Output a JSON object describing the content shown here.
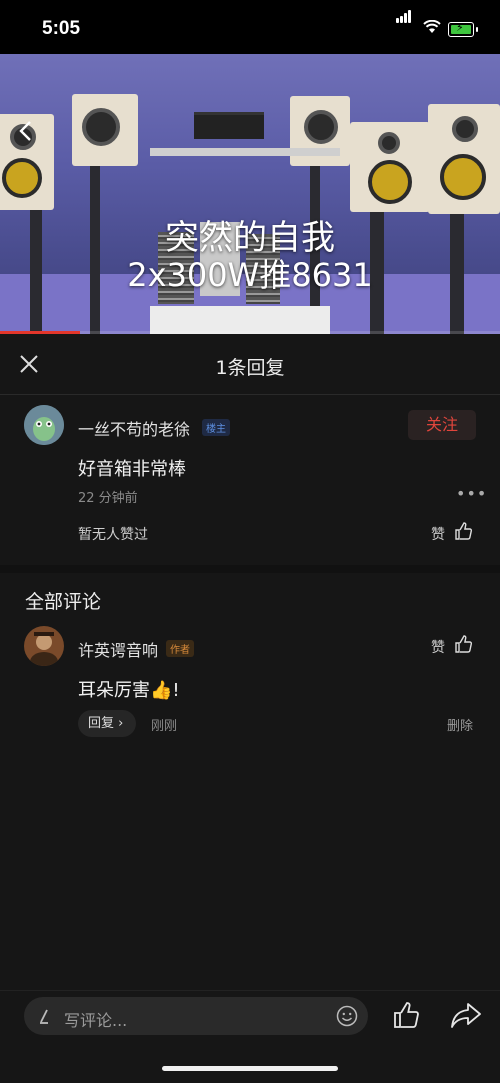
{
  "status_bar": {
    "time": "5:05"
  },
  "video": {
    "title_line1": "突然的自我",
    "title_line2": "2x300W推8631",
    "progress": 0.16
  },
  "header": {
    "title": "1条回复"
  },
  "main_comment": {
    "author": "一丝不苟的老徐",
    "badge": "楼主",
    "follow_label": "关注",
    "text": "好音箱非常棒",
    "time": "22 分钟前",
    "likes_text": "暂无人赞过",
    "like_label": "赞"
  },
  "section": {
    "title": "全部评论"
  },
  "reply_comment": {
    "author": "许英谔音响",
    "badge": "作者",
    "text": "耳朵厉害",
    "emoji": "👍",
    "text_suffix": "!",
    "like_label": "赞",
    "reply_label": "回复",
    "time": "刚刚",
    "delete_label": "删除"
  },
  "bottom_bar": {
    "placeholder": "写评论..."
  },
  "colors": {
    "accent_red": "#e0453c",
    "background": "#161616",
    "progress": "#e3362b"
  }
}
